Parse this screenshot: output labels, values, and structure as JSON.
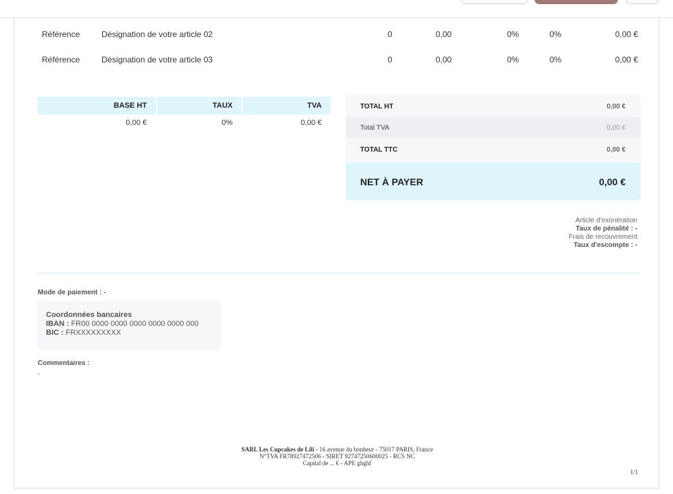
{
  "articles": [
    {
      "ref": "Référence",
      "designation": "Désignation de votre article 02",
      "qty": "0",
      "pu": "0,00",
      "remise": "0%",
      "tva": "0%",
      "total": "0,00 €"
    },
    {
      "ref": "Référence",
      "designation": "Désignation de votre article 03",
      "qty": "0",
      "pu": "0,00",
      "remise": "0%",
      "tva": "0%",
      "total": "0,00 €"
    }
  ],
  "vat_table": {
    "headers": [
      "BASE HT",
      "TAUX",
      "TVA"
    ],
    "row": [
      "0,00 €",
      "0%",
      "0,00 €"
    ]
  },
  "totals": {
    "total_ht_label": "TOTAL HT",
    "total_ht": "0,00 €",
    "total_tva_label": "Total TVA",
    "total_tva": "0,00 €",
    "total_ttc_label": "TOTAL TTC",
    "total_ttc": "0,00 €",
    "net_label": "NET À PAYER",
    "net": "0,00 €"
  },
  "legal": {
    "exoneration": "Article d'exonération",
    "penalite": "Taux de pénalité : -",
    "recouvrement": "Frais de recouvrement",
    "escompte": "Taux d'escompte : -"
  },
  "payment": {
    "mode": "Mode de paiement : -",
    "bank_title": "Coordonnées bancaires",
    "iban_label": "IBAN :",
    "iban": "FR00 0000 0000 0000 0000 0000 000",
    "bic_label": "BIC :",
    "bic": "FRXXXXXXXXX"
  },
  "comments": {
    "title": "Commentaires :",
    "value": "-"
  },
  "footer": {
    "company": "SARL Les Cupcakes de Lili -",
    "address": "16 avenue du bonheur - 75017 PARIS, France",
    "line2": "N°TVA FR78927472506 - SIRET 92747250600025 - RCS NC",
    "line3": "Capital de ... € - APE ghghf"
  },
  "page_number": "1/1",
  "colors": {
    "accent_light": "#def5fb",
    "primary_button": "#a07878",
    "panel": "#f6f7f9"
  }
}
